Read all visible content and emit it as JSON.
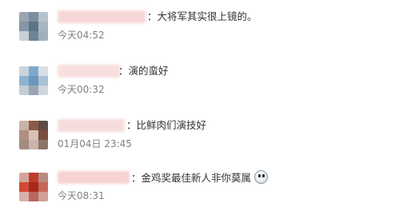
{
  "comments": [
    {
      "text": "：大将军其实很上镜的。",
      "time": "今天04:52",
      "name_color": "#f7d6d6",
      "avatar_colors": [
        "#9aa6b1",
        "#7b8e9e",
        "#b8c2cc",
        "#8596a6",
        "#5c7488",
        "#a9b5c0",
        "#c8d0d8",
        "#6e8597",
        "#9fb0bf"
      ]
    },
    {
      "text": "：演的蛮好",
      "time": "今天00:32",
      "name_color": "#f8dede",
      "avatar_colors": [
        "#c9d3dc",
        "#7fa8c8",
        "#d8dfe6",
        "#8db3d0",
        "#6b97bd",
        "#a7c1d6",
        "#c4cdd5",
        "#9aa7b3",
        "#d0d7de"
      ]
    },
    {
      "text": "：比鲜肉们演技好",
      "time": "01月04日 23:45",
      "name_color": "#f7dcdc",
      "avatar_colors": [
        "#c7b2a6",
        "#8a5a4a",
        "#5e4a44",
        "#b08e80",
        "#d9c2b5",
        "#7a4e3f",
        "#a48c82",
        "#c9b4aa",
        "#8e7468"
      ]
    },
    {
      "text": "：金鸡奖最佳新人非你莫属",
      "time": "今天08:31",
      "name_color": "#f6d2d2",
      "avatar_colors": [
        "#d3a59a",
        "#c23a2a",
        "#b88a80",
        "#d14a35",
        "#a8281c",
        "#c4685a",
        "#d9b0a8",
        "#b8675c",
        "#cfa098"
      ],
      "emoji": "astonished-face"
    }
  ]
}
